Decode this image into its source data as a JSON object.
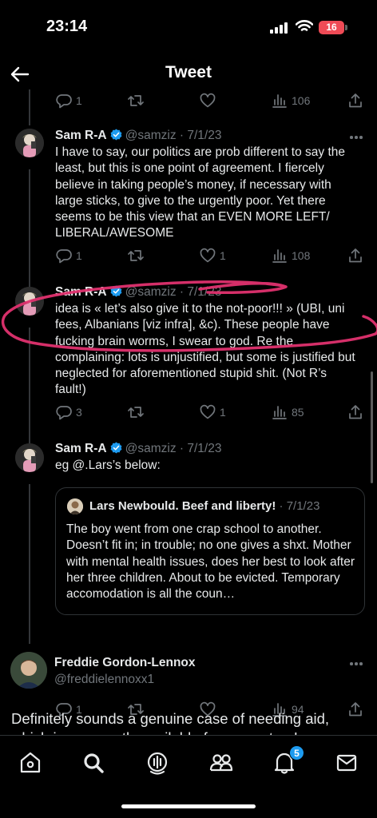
{
  "status": {
    "time": "23:14",
    "battery": "16"
  },
  "header": {
    "title": "Tweet"
  },
  "top_actions": {
    "replies": "1",
    "views": "106"
  },
  "tweets": [
    {
      "name": "Sam R-A",
      "handle": "@samziz",
      "date": "· 7/1/23",
      "text": "I have to say, our politics are prob different to say the least, but this is one point of agreement. I fiercely believe in taking people’s money, if necessary with large sticks, to give to the urgently poor. Yet there seems to be this view that an EVEN MORE LEFT/ LIBERAL/AWESOME",
      "replies": "1",
      "likes": "1",
      "views": "108"
    },
    {
      "name": "Sam R-A",
      "handle": "@samziz",
      "date": "· 7/1/23",
      "text": "idea is « let’s also give it to the not-poor!!! » (UBI, uni fees, Albanians [viz infra], &c). These people have fucking brain worms, I swear to god. Re the complaining: lots is unjustified, but some is justified but neglected for aforementioned stupid shit. (Not R’s fault!)",
      "replies": "3",
      "likes": "1",
      "views": "85"
    },
    {
      "name": "Sam R-A",
      "handle": "@samziz",
      "date": "· 7/1/23",
      "text": "eg @.Lars’s below:",
      "replies": "1",
      "likes": "",
      "views": "94",
      "quote": {
        "name": "Lars Newbould. Beef and liberty!",
        "date": "· 7/1/23",
        "text": "The boy went from one crap school to another. Doesn’t fit in; in trouble; no one gives a shxt. Mother with mental health issues, does her best to look after her three children. About to be evicted. Temporary accomodation is all the coun…"
      }
    }
  ],
  "reply": {
    "name": "Freddie Gordon-Lennox",
    "handle": "@freddielennoxx1",
    "text": "Definitely sounds a genuine case of needing aid, which is apparently available for computers!"
  },
  "tabbar": {
    "notifications_badge": "5"
  },
  "colors": {
    "accent": "#1d9bf0",
    "annotation": "#e0326f",
    "battery": "#ef4b56"
  }
}
